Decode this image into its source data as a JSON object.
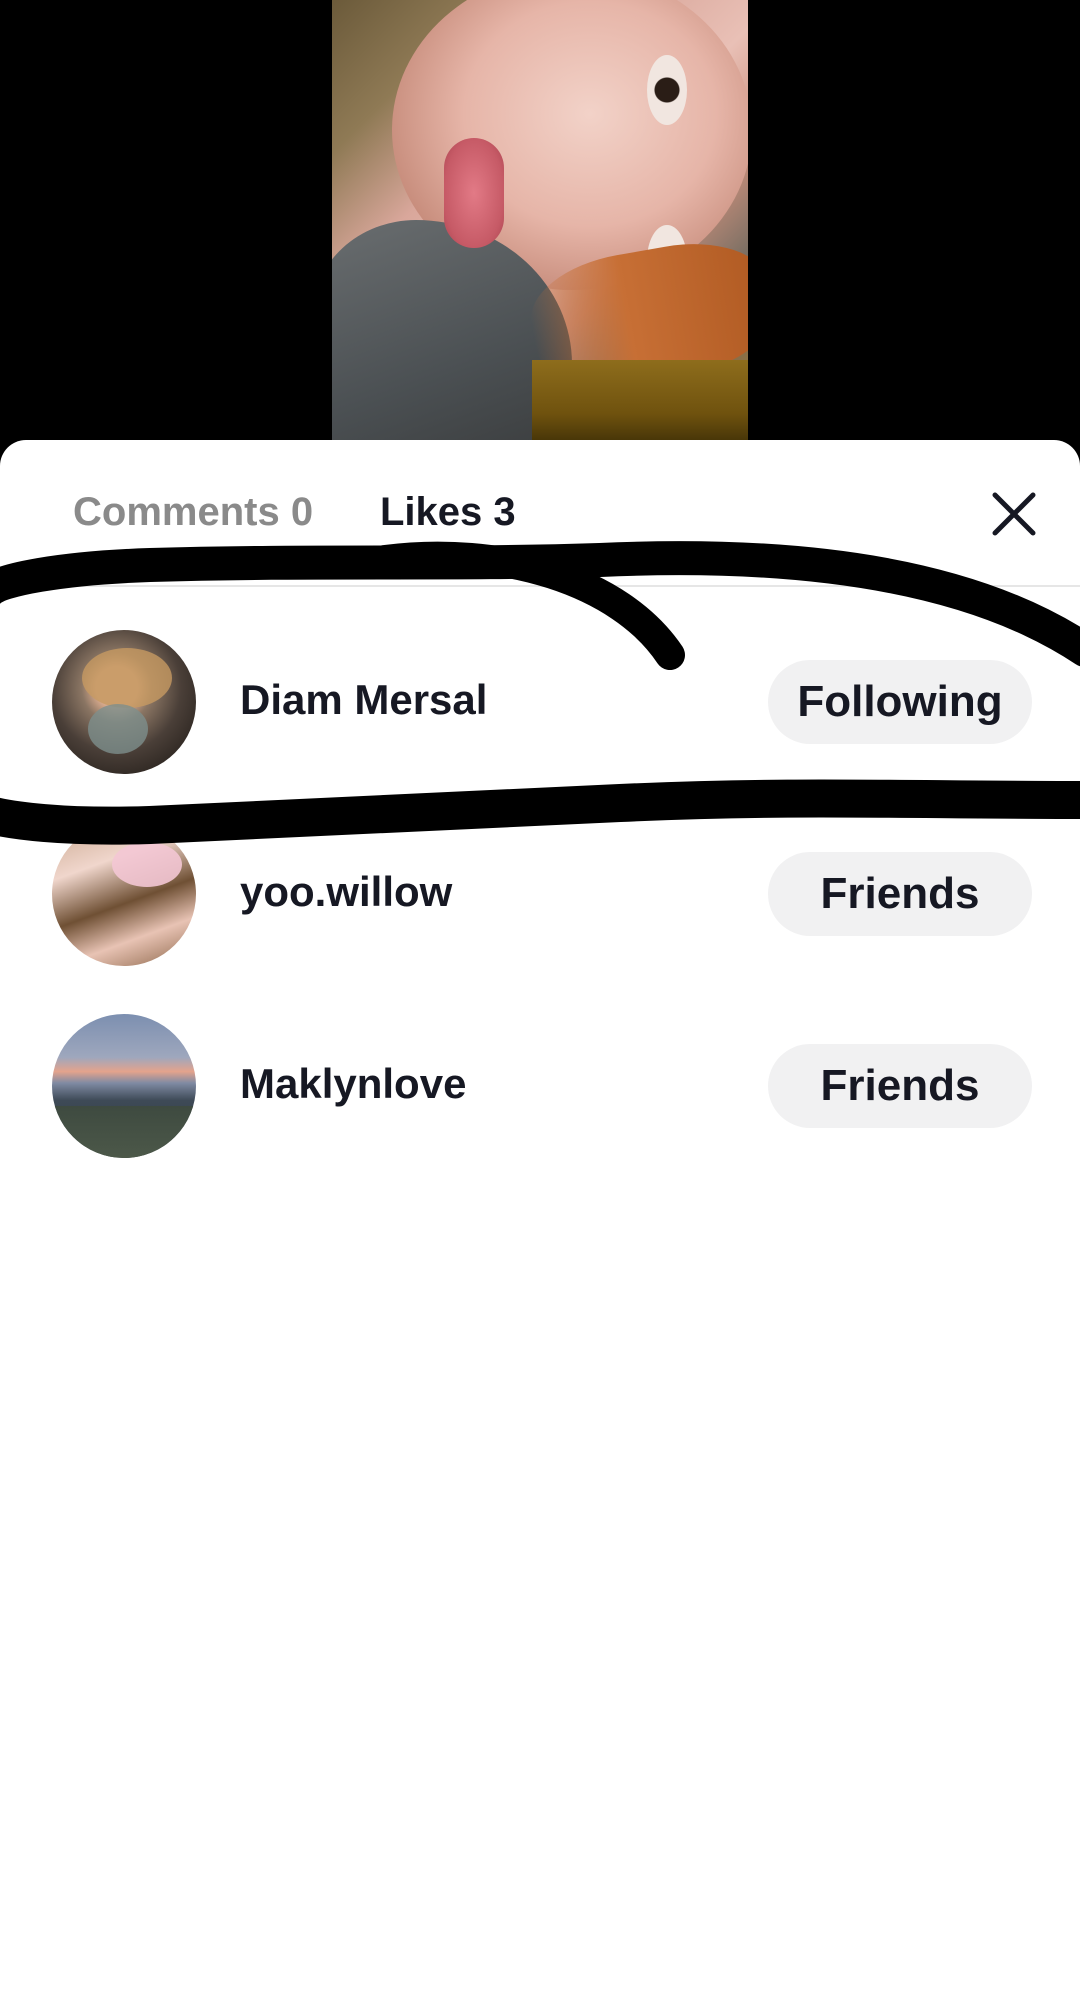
{
  "tabs": {
    "comments": "Comments 0",
    "likes": "Likes 3"
  },
  "users": [
    {
      "name": "Diam Mersal",
      "status": "Following"
    },
    {
      "name": "yoo.willow",
      "status": "Friends"
    },
    {
      "name": "Maklynlove",
      "status": "Friends"
    }
  ],
  "icons": {
    "close": "close-icon"
  },
  "colors": {
    "text": "#161823",
    "muted_tab": "#8a8a8a",
    "pill_bg": "#f1f1f2",
    "annotation": "#000000"
  }
}
